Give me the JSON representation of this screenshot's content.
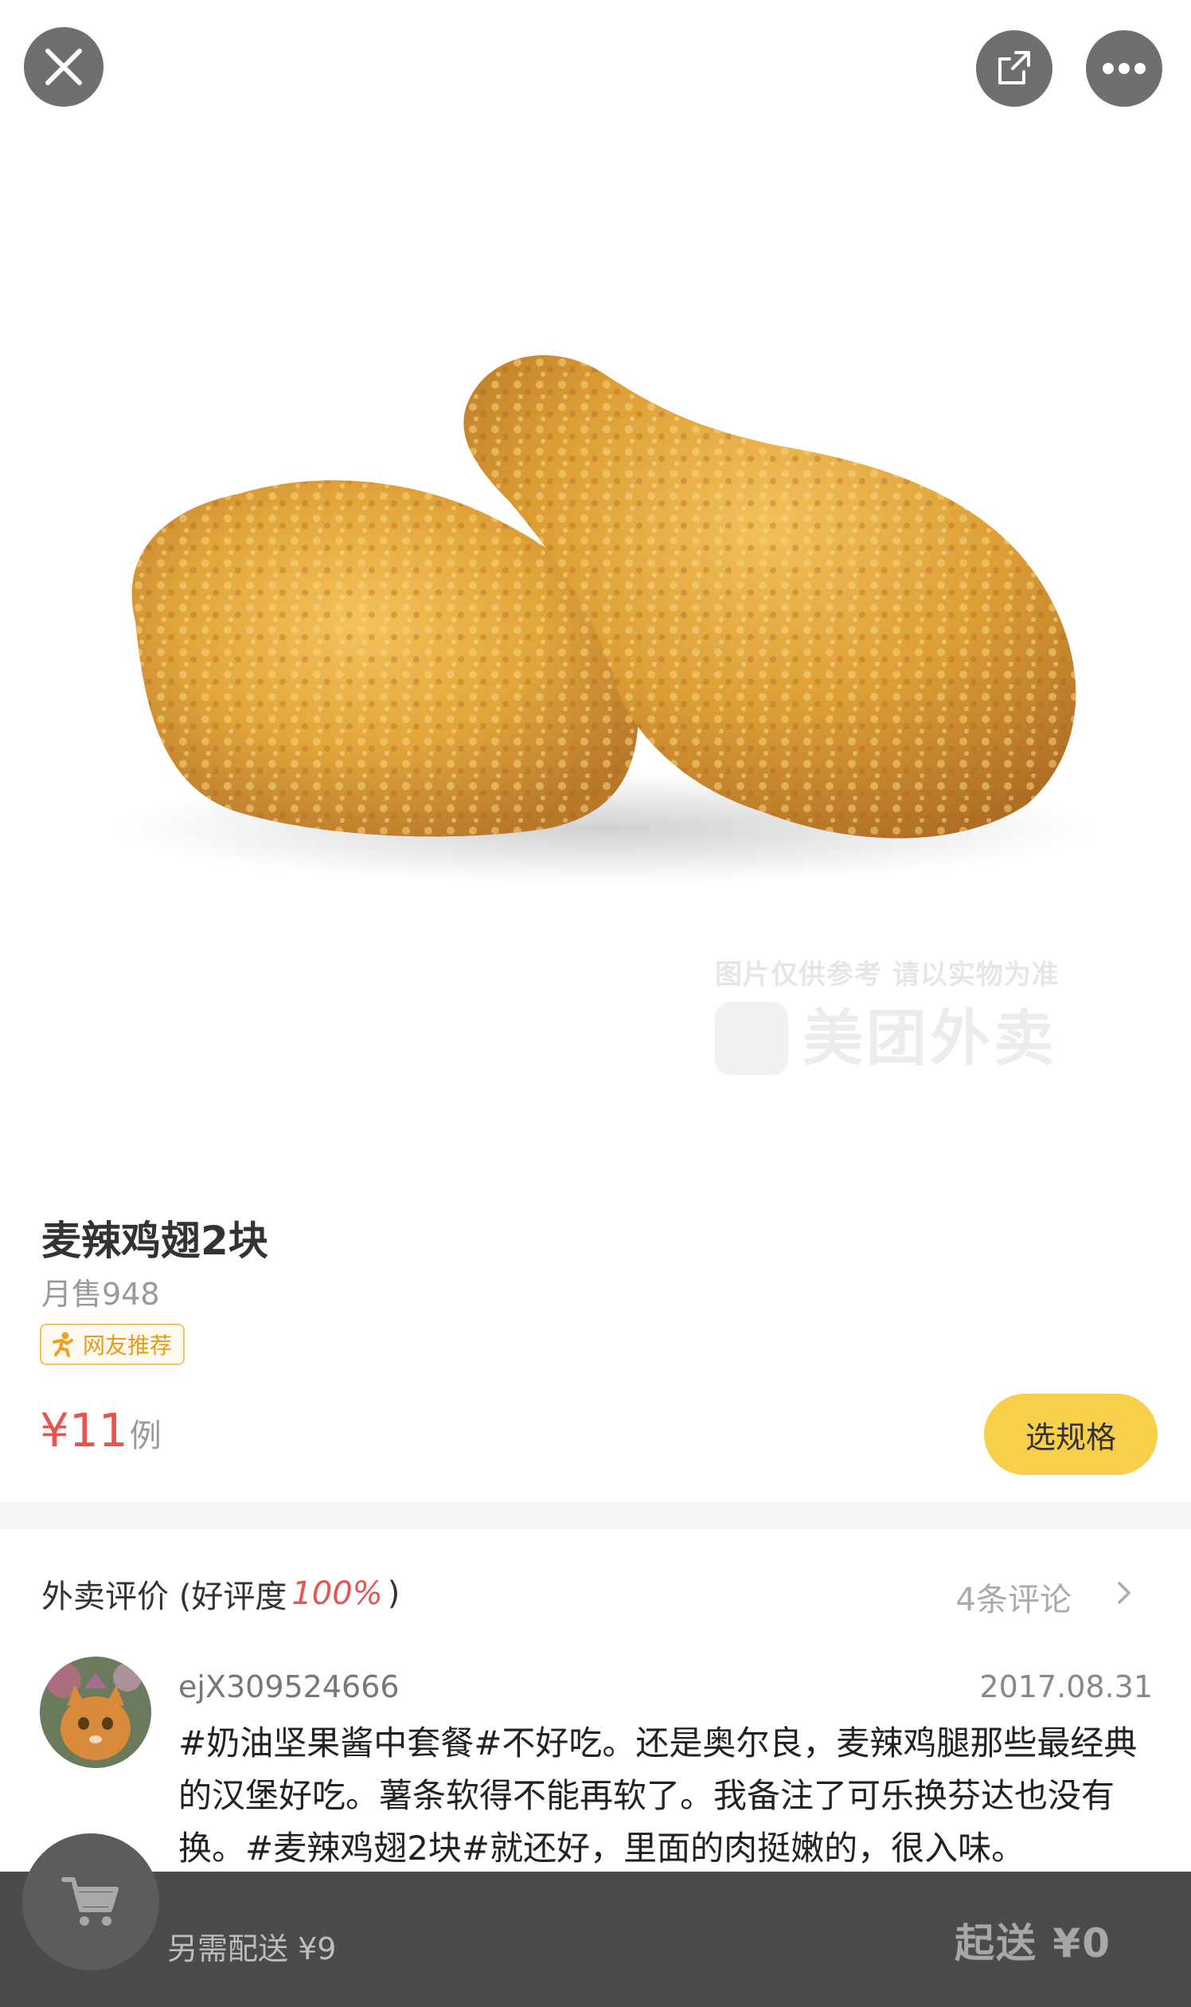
{
  "header": {
    "close_icon": "close-icon",
    "share_icon": "share-icon",
    "more_icon": "more-dots-icon"
  },
  "photo": {
    "watermark_caption": "图片仅供参考 请以实物为准",
    "watermark_brand": "美团外卖"
  },
  "product": {
    "name": "麦辣鸡翅2块",
    "monthly_sales": "月售948",
    "badge": "网友推荐",
    "badge_icon": "person-run-icon",
    "price": "¥11",
    "price_unit": "例",
    "select_label": "选规格"
  },
  "reviews": {
    "title_prefix": "外卖评价 (",
    "rating_label": "好评度",
    "rating_value": "100%",
    "title_suffix": ")",
    "count": "4条评论",
    "items": [
      {
        "user": "ejX309524666",
        "date": "2017.08.31",
        "text": "#奶油坚果酱中套餐#不好吃。还是奥尔良，麦辣鸡腿那些最经典的汉堡好吃。薯条软得不能再软了。我备注了可乐换芬达也没有换。#麦辣鸡翅2块#就还好，里面的肉挺嫩的，很入味。"
      }
    ]
  },
  "cart": {
    "extra_fee": "另需配送 ¥9",
    "min_order": "起送 ¥0",
    "cart_icon": "cart-icon"
  },
  "colors": {
    "accent_yellow": "#f8cf4a",
    "price_red": "#e8544e",
    "bar_gray": "#4b4b4b"
  }
}
